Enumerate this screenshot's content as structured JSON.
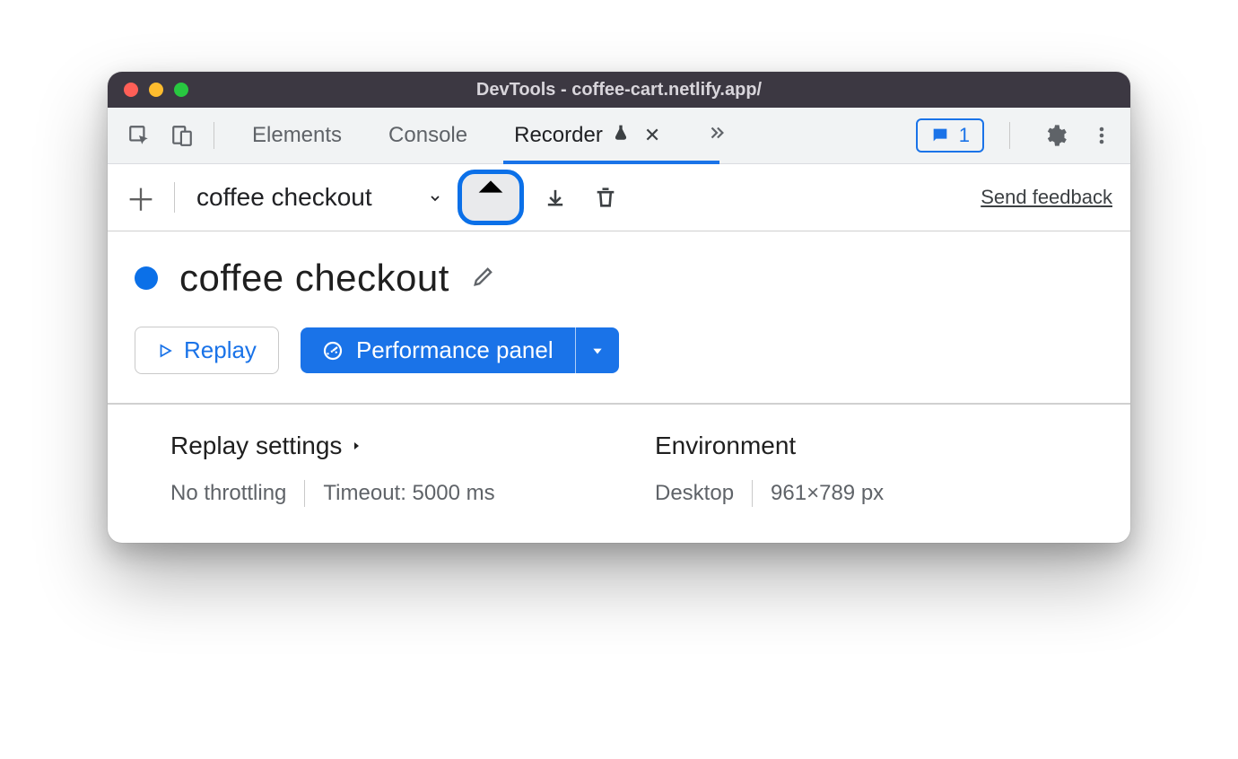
{
  "window": {
    "title": "DevTools - coffee-cart.netlify.app/"
  },
  "tabs": {
    "elements": "Elements",
    "console": "Console",
    "recorder": "Recorder"
  },
  "messages_badge": "1",
  "rec_toolbar": {
    "recording_name": "coffee checkout",
    "feedback": "Send feedback"
  },
  "recording": {
    "title": "coffee checkout",
    "replay_label": "Replay",
    "perf_label": "Performance panel"
  },
  "settings": {
    "replay_heading": "Replay settings",
    "throttling": "No throttling",
    "timeout": "Timeout: 5000 ms",
    "env_heading": "Environment",
    "env_device": "Desktop",
    "env_size": "961×789 px"
  }
}
